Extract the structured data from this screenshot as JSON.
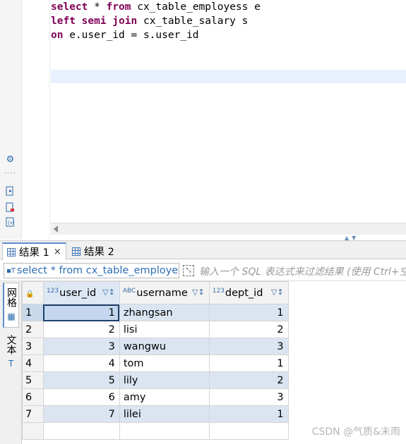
{
  "editor": {
    "lines": [
      {
        "k1": "select",
        "t1": " * ",
        "k2": "from",
        "t2": " cx_table_employess e"
      },
      {
        "k1": "left",
        "t1": " ",
        "k2": "semi join",
        "t2": " cx_table_salary s"
      },
      {
        "k1": "on",
        "t1": " e.user_id = s.user_id",
        "k2": "",
        "t2": ""
      }
    ]
  },
  "results": {
    "tabs": [
      {
        "label": "结果 1",
        "close": "×"
      },
      {
        "label": "结果 2"
      }
    ],
    "filter": {
      "query_text": "select * from cx_table_employess e",
      "placeholder": "输入一个 SQL 表达式来过滤结果 (使用 Ctrl+空格)"
    },
    "side_tabs": [
      "网格",
      "文本"
    ],
    "columns": [
      {
        "type": "123",
        "name": "user_id",
        "sort_icon": "filter-sort-icon"
      },
      {
        "type": "ABC",
        "name": "username",
        "sort_icon": "filter-sort-icon"
      },
      {
        "type": "123",
        "name": "dept_id",
        "sort_icon": "filter-sort-icon"
      }
    ],
    "rows": [
      {
        "n": "1",
        "user_id": "1",
        "username": "zhangsan",
        "dept_id": "1"
      },
      {
        "n": "2",
        "user_id": "2",
        "username": "lisi",
        "dept_id": "2"
      },
      {
        "n": "3",
        "user_id": "3",
        "username": "wangwu",
        "dept_id": "3"
      },
      {
        "n": "4",
        "user_id": "4",
        "username": "tom",
        "dept_id": "1"
      },
      {
        "n": "5",
        "user_id": "5",
        "username": "lily",
        "dept_id": "2"
      },
      {
        "n": "6",
        "user_id": "6",
        "username": "amy",
        "dept_id": "3"
      },
      {
        "n": "7",
        "user_id": "7",
        "username": "lilei",
        "dept_id": "1"
      }
    ]
  },
  "watermark": "CSDN @气质&末雨"
}
